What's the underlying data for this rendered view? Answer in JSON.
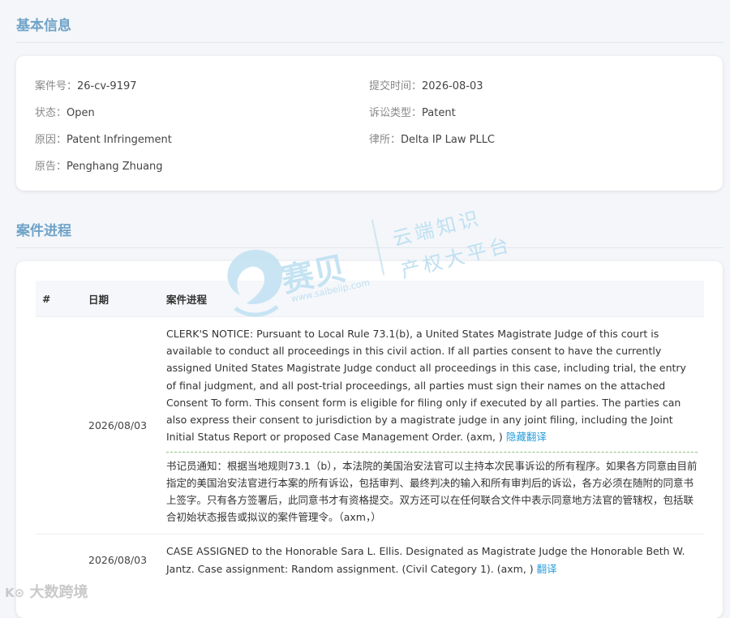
{
  "basic": {
    "title": "基本信息",
    "fields": [
      {
        "label": "案件号：",
        "value": "26-cv-9197"
      },
      {
        "label": "提交时间：",
        "value": "2026-08-03"
      },
      {
        "label": "状态：",
        "value": "Open"
      },
      {
        "label": "诉讼类型：",
        "value": "Patent"
      },
      {
        "label": "原因：",
        "value": "Patent Infringement"
      },
      {
        "label": "律所：",
        "value": "Delta IP Law PLLC"
      },
      {
        "label": "原告：",
        "value": "Penghang Zhuang"
      }
    ]
  },
  "progress": {
    "title": "案件进程",
    "headers": {
      "num": "#",
      "date": "日期",
      "proc": "案件进程"
    },
    "rows": [
      {
        "date": "2026/08/03",
        "text": "CLERK'S NOTICE: Pursuant to Local Rule 73.1(b), a United States Magistrate Judge of this court is available to conduct all proceedings in this civil action. If all parties consent to have the currently assigned United States Magistrate Judge conduct all proceedings in this case, including trial, the entry of final judgment, and all post-trial proceedings, all parties must sign their names on the attached Consent To form. This consent form is eligible for filing only if executed by all parties. The parties can also express their consent to jurisdiction by a magistrate judge in any joint filing, including the Joint Initial Status Report or proposed Case Management Order. (axm, )",
        "link": "隐藏翻译",
        "translation": "书记员通知：根据当地规则73.1（b），本法院的美国治安法官可以主持本次民事诉讼的所有程序。如果各方同意由目前指定的美国治安法官进行本案的所有诉讼，包括审判、最终判决的输入和所有审判后的诉讼，各方必须在随附的同意书上签字。只有各方签署后，此同意书才有资格提交。双方还可以在任何联合文件中表示同意地方法官的管辖权，包括联合初始状态报告或拟议的案件管理令。（axm，）"
      },
      {
        "date": "2026/08/03",
        "text": "CASE ASSIGNED to the Honorable Sara L. Ellis. Designated as Magistrate Judge the Honorable Beth W. Jantz. Case assignment: Random assignment. (Civil Category 1). (axm, )",
        "link": "翻译"
      }
    ]
  },
  "watermark": {
    "brand": "赛贝",
    "url": "www.saibeiip.com",
    "slogan1": "云端知识",
    "slogan2": "产权大平台"
  },
  "footer": {
    "brand": "大数跨境"
  }
}
